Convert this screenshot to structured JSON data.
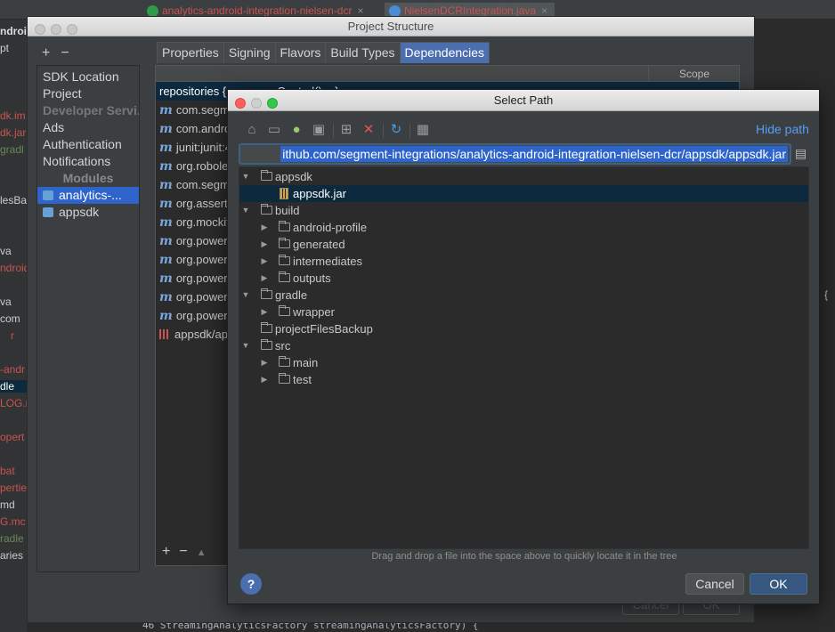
{
  "ide": {
    "tabs": [
      {
        "label": "analytics-android-integration-nielsen-dcr",
        "close": "×"
      },
      {
        "label": "NielsenDCRIntegration.java",
        "close": "×"
      }
    ],
    "left_fragments": [
      "ndroi",
      "pt",
      "dk.im",
      "dk.jar",
      "gradl",
      "lesBac",
      "va",
      "ndroid",
      "va",
      "com",
      "r",
      "-andr",
      "dle",
      "LOG.r",
      "opert",
      "bat",
      "pertie",
      "md",
      "G.mc",
      "radle",
      "aries"
    ],
    "right_glyphs": [
      "{",
      "{"
    ],
    "bottom_code_line": "46      StreamingAnalyticsFactory streamingAnalyticsFactory) {"
  },
  "project_structure": {
    "title": "Project Structure",
    "toolbar": {
      "add": "+",
      "remove": "−"
    },
    "sidebar": {
      "items": [
        {
          "label": "SDK Location"
        },
        {
          "label": "Project"
        },
        {
          "label": "Developer Servi..."
        },
        {
          "label": "Ads"
        },
        {
          "label": "Authentication"
        },
        {
          "label": "Notifications"
        }
      ],
      "modules_header": "Modules",
      "modules": [
        {
          "label": "analytics-..."
        },
        {
          "label": "appsdk"
        }
      ]
    },
    "tabs": [
      "Properties",
      "Signing",
      "Flavors",
      "Build Types",
      "Dependencies"
    ],
    "scope_header": "Scope",
    "dependencies": [
      {
        "label": "repositories { ... mavenCentral() ...}"
      },
      {
        "label": "com.segm"
      },
      {
        "label": "com.andro"
      },
      {
        "label": "junit:junit:4"
      },
      {
        "label": "org.robole"
      },
      {
        "label": "com.segm"
      },
      {
        "label": "org.assertj"
      },
      {
        "label": "org.mockit"
      },
      {
        "label": "org.power"
      },
      {
        "label": "org.power"
      },
      {
        "label": "org.power"
      },
      {
        "label": "org.power"
      },
      {
        "label": "org.power"
      },
      {
        "label": "appsdk/ap"
      }
    ],
    "m_glyph": "m",
    "bottom_bar": {
      "add": "+",
      "remove": "−",
      "up": "▲"
    },
    "buttons": {
      "cancel": "Cancel",
      "ok": "OK"
    }
  },
  "select_path": {
    "title": "Select Path",
    "toolbar_icons": [
      "home-icon",
      "desktop-icon",
      "android-icon",
      "project-folder-icon",
      "module-folder-icon",
      "new-folder-icon",
      "delete-icon",
      "refresh-icon",
      "show-hidden-icon"
    ],
    "hide_path": "Hide path",
    "path": "ithub.com/segment-integrations/analytics-android-integration-nielsen-dcr/appsdk/appsdk.jar",
    "tree": [
      {
        "label": "appsdk",
        "expanded": true,
        "type": "folder"
      },
      {
        "label": "appsdk.jar",
        "type": "jar",
        "selected": true
      },
      {
        "label": "build",
        "expanded": true,
        "type": "folder"
      },
      {
        "label": "android-profile",
        "expanded": false,
        "type": "folder"
      },
      {
        "label": "generated",
        "expanded": false,
        "type": "folder"
      },
      {
        "label": "intermediates",
        "expanded": false,
        "type": "folder"
      },
      {
        "label": "outputs",
        "expanded": false,
        "type": "folder"
      },
      {
        "label": "gradle",
        "expanded": true,
        "type": "folder"
      },
      {
        "label": "wrapper",
        "expanded": false,
        "type": "folder"
      },
      {
        "label": "projectFilesBackup",
        "type": "folder"
      },
      {
        "label": "src",
        "expanded": true,
        "type": "folder"
      },
      {
        "label": "main",
        "expanded": false,
        "type": "folder"
      },
      {
        "label": "test",
        "expanded": false,
        "type": "folder"
      }
    ],
    "hint": "Drag and drop a file into the space above to quickly locate it in the tree",
    "help": "?",
    "cancel": "Cancel",
    "ok": "OK"
  },
  "colors": {
    "accent_blue": "#2f65ca",
    "link_blue": "#589df6",
    "selection_dark": "#0d293e",
    "ok_button": "#365880",
    "error_red": "#c75450"
  }
}
